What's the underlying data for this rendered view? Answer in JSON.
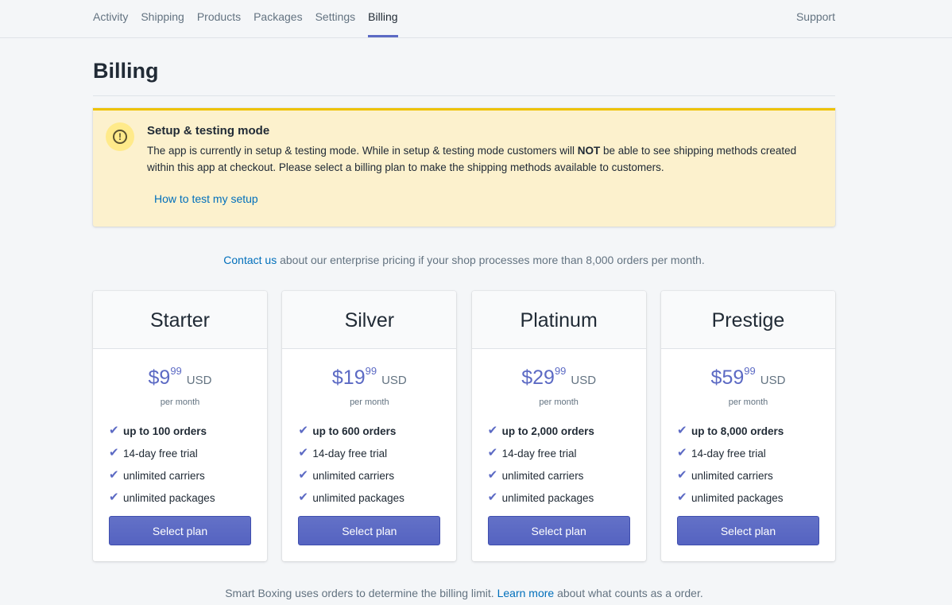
{
  "nav": {
    "items": [
      "Activity",
      "Shipping",
      "Products",
      "Packages",
      "Settings",
      "Billing"
    ],
    "active": "Billing",
    "support": "Support"
  },
  "page": {
    "title": "Billing"
  },
  "banner": {
    "title": "Setup & testing mode",
    "text_before": "The app is currently in setup & testing mode. While in setup & testing mode customers will ",
    "text_bold": "NOT",
    "text_after": " be able to see shipping methods created within this app at checkout. Please select a billing plan to make the shipping methods available to customers.",
    "link": "How to test my setup",
    "icon": "warning-icon"
  },
  "contact": {
    "link": "Contact us",
    "text": " about our enterprise pricing if your shop processes more than 8,000 orders per month."
  },
  "plans": [
    {
      "name": "Starter",
      "price": "$9",
      "cents": "99",
      "currency": "USD",
      "period": "per month",
      "features": [
        "up to 100 orders",
        "14-day free trial",
        "unlimited carriers",
        "unlimited packages"
      ],
      "button": "Select plan"
    },
    {
      "name": "Silver",
      "price": "$19",
      "cents": "99",
      "currency": "USD",
      "period": "per month",
      "features": [
        "up to 600 orders",
        "14-day free trial",
        "unlimited carriers",
        "unlimited packages"
      ],
      "button": "Select plan"
    },
    {
      "name": "Platinum",
      "price": "$29",
      "cents": "99",
      "currency": "USD",
      "period": "per month",
      "features": [
        "up to 2,000 orders",
        "14-day free trial",
        "unlimited carriers",
        "unlimited packages"
      ],
      "button": "Select plan"
    },
    {
      "name": "Prestige",
      "price": "$59",
      "cents": "99",
      "currency": "USD",
      "period": "per month",
      "features": [
        "up to 8,000 orders",
        "14-day free trial",
        "unlimited carriers",
        "unlimited packages"
      ],
      "button": "Select plan"
    }
  ],
  "footer": {
    "text_before": "Smart Boxing uses orders to determine the billing limit. ",
    "link": "Learn more",
    "text_after": " about what counts as a order."
  },
  "colors": {
    "accent": "#5c6ac4",
    "link": "#006fbb",
    "banner_bg": "#fcf1cd",
    "banner_border": "#eec200"
  }
}
